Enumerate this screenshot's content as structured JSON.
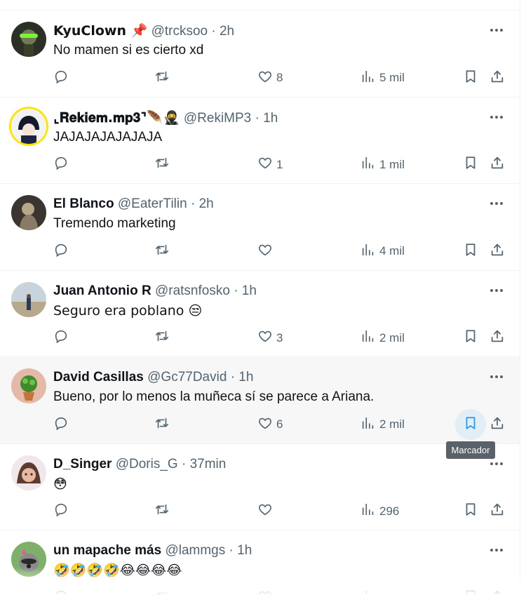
{
  "tooltip": "Marcador",
  "tweets": [
    {
      "name": "KyuClown 📌",
      "handle": "@trcksoo",
      "sep": "·",
      "time": "2h",
      "text": "No mamen si es cierto xd",
      "likes": "8",
      "views": "5 mil"
    },
    {
      "name": "⌞𝐑𝐞𝐤𝐢𝐞𝐦.𝐦𝐩𝟑⌝🪶🥷",
      "handle": "@RekiMP3",
      "sep": "·",
      "time": "1h",
      "text": "JAJAJAJAJAJAJA",
      "likes": "1",
      "views": "1 mil"
    },
    {
      "name": "El Blanco",
      "handle": "@EaterTilin",
      "sep": "·",
      "time": "2h",
      "text": "Tremendo marketing",
      "likes": "",
      "views": "4 mil"
    },
    {
      "name": "Juan Antonio R",
      "handle": "@ratsnfosko",
      "sep": "·",
      "time": "1h",
      "text": "Seguro era poblano 😒",
      "likes": "3",
      "views": "2 mil"
    },
    {
      "name": "David Casillas",
      "handle": "@Gc77David",
      "sep": "·",
      "time": "1h",
      "text": "Bueno, por lo menos la muñeca sí se parece a Ariana.",
      "likes": "6",
      "views": "2 mil"
    },
    {
      "name": "D_Singer",
      "handle": "@Doris_G",
      "sep": "·",
      "time": "37min",
      "text": "😳",
      "likes": "",
      "views": "296"
    },
    {
      "name": "un mapache más",
      "handle": "@lammgs",
      "sep": "·",
      "time": "1h",
      "text": "🤣🤣🤣🤣😂😂😂😂",
      "likes": "",
      "views": ""
    }
  ]
}
